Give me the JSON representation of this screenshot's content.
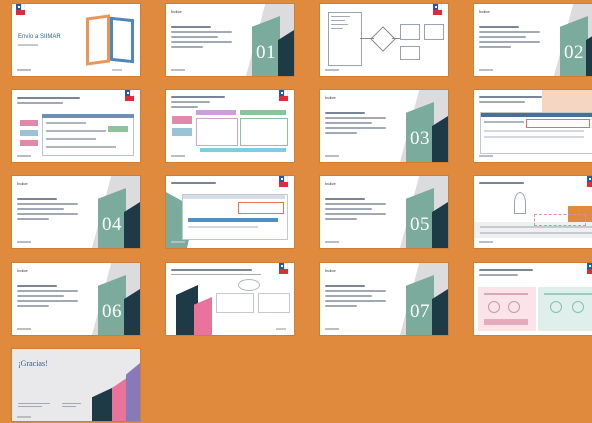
{
  "slides": [
    {
      "id": "s1",
      "title": "Envío a SIIMAR",
      "subtitle": "",
      "type": "cover"
    },
    {
      "id": "s2",
      "label": "Índice",
      "section": "01",
      "type": "section"
    },
    {
      "id": "s3",
      "label": "",
      "type": "flowchart"
    },
    {
      "id": "s4",
      "label": "Índice",
      "section": "02",
      "type": "section"
    },
    {
      "id": "s5",
      "title": "",
      "type": "table"
    },
    {
      "id": "s6",
      "title": "",
      "type": "table"
    },
    {
      "id": "s7",
      "label": "Índice",
      "section": "03",
      "type": "section"
    },
    {
      "id": "s8",
      "title": "",
      "type": "screenshot"
    },
    {
      "id": "s9",
      "label": "Índice",
      "section": "04",
      "type": "section"
    },
    {
      "id": "s10",
      "title": "",
      "type": "screenshot"
    },
    {
      "id": "s11",
      "label": "Índice",
      "section": "05",
      "type": "section"
    },
    {
      "id": "s12",
      "title": "",
      "type": "screenshot"
    },
    {
      "id": "s13",
      "label": "Índice",
      "section": "06",
      "type": "section"
    },
    {
      "id": "s14",
      "title": "",
      "type": "diagram"
    },
    {
      "id": "s15",
      "label": "Índice",
      "section": "07",
      "type": "section"
    },
    {
      "id": "s16",
      "title": "",
      "type": "infographic"
    },
    {
      "id": "s17",
      "title": "¡Gracias!",
      "type": "closing"
    }
  ],
  "colors": {
    "background": "#e08a3e",
    "teal": "#7aab9c",
    "dark": "#1f3a47",
    "pink": "#e8739b",
    "purple": "#8a79b8"
  }
}
